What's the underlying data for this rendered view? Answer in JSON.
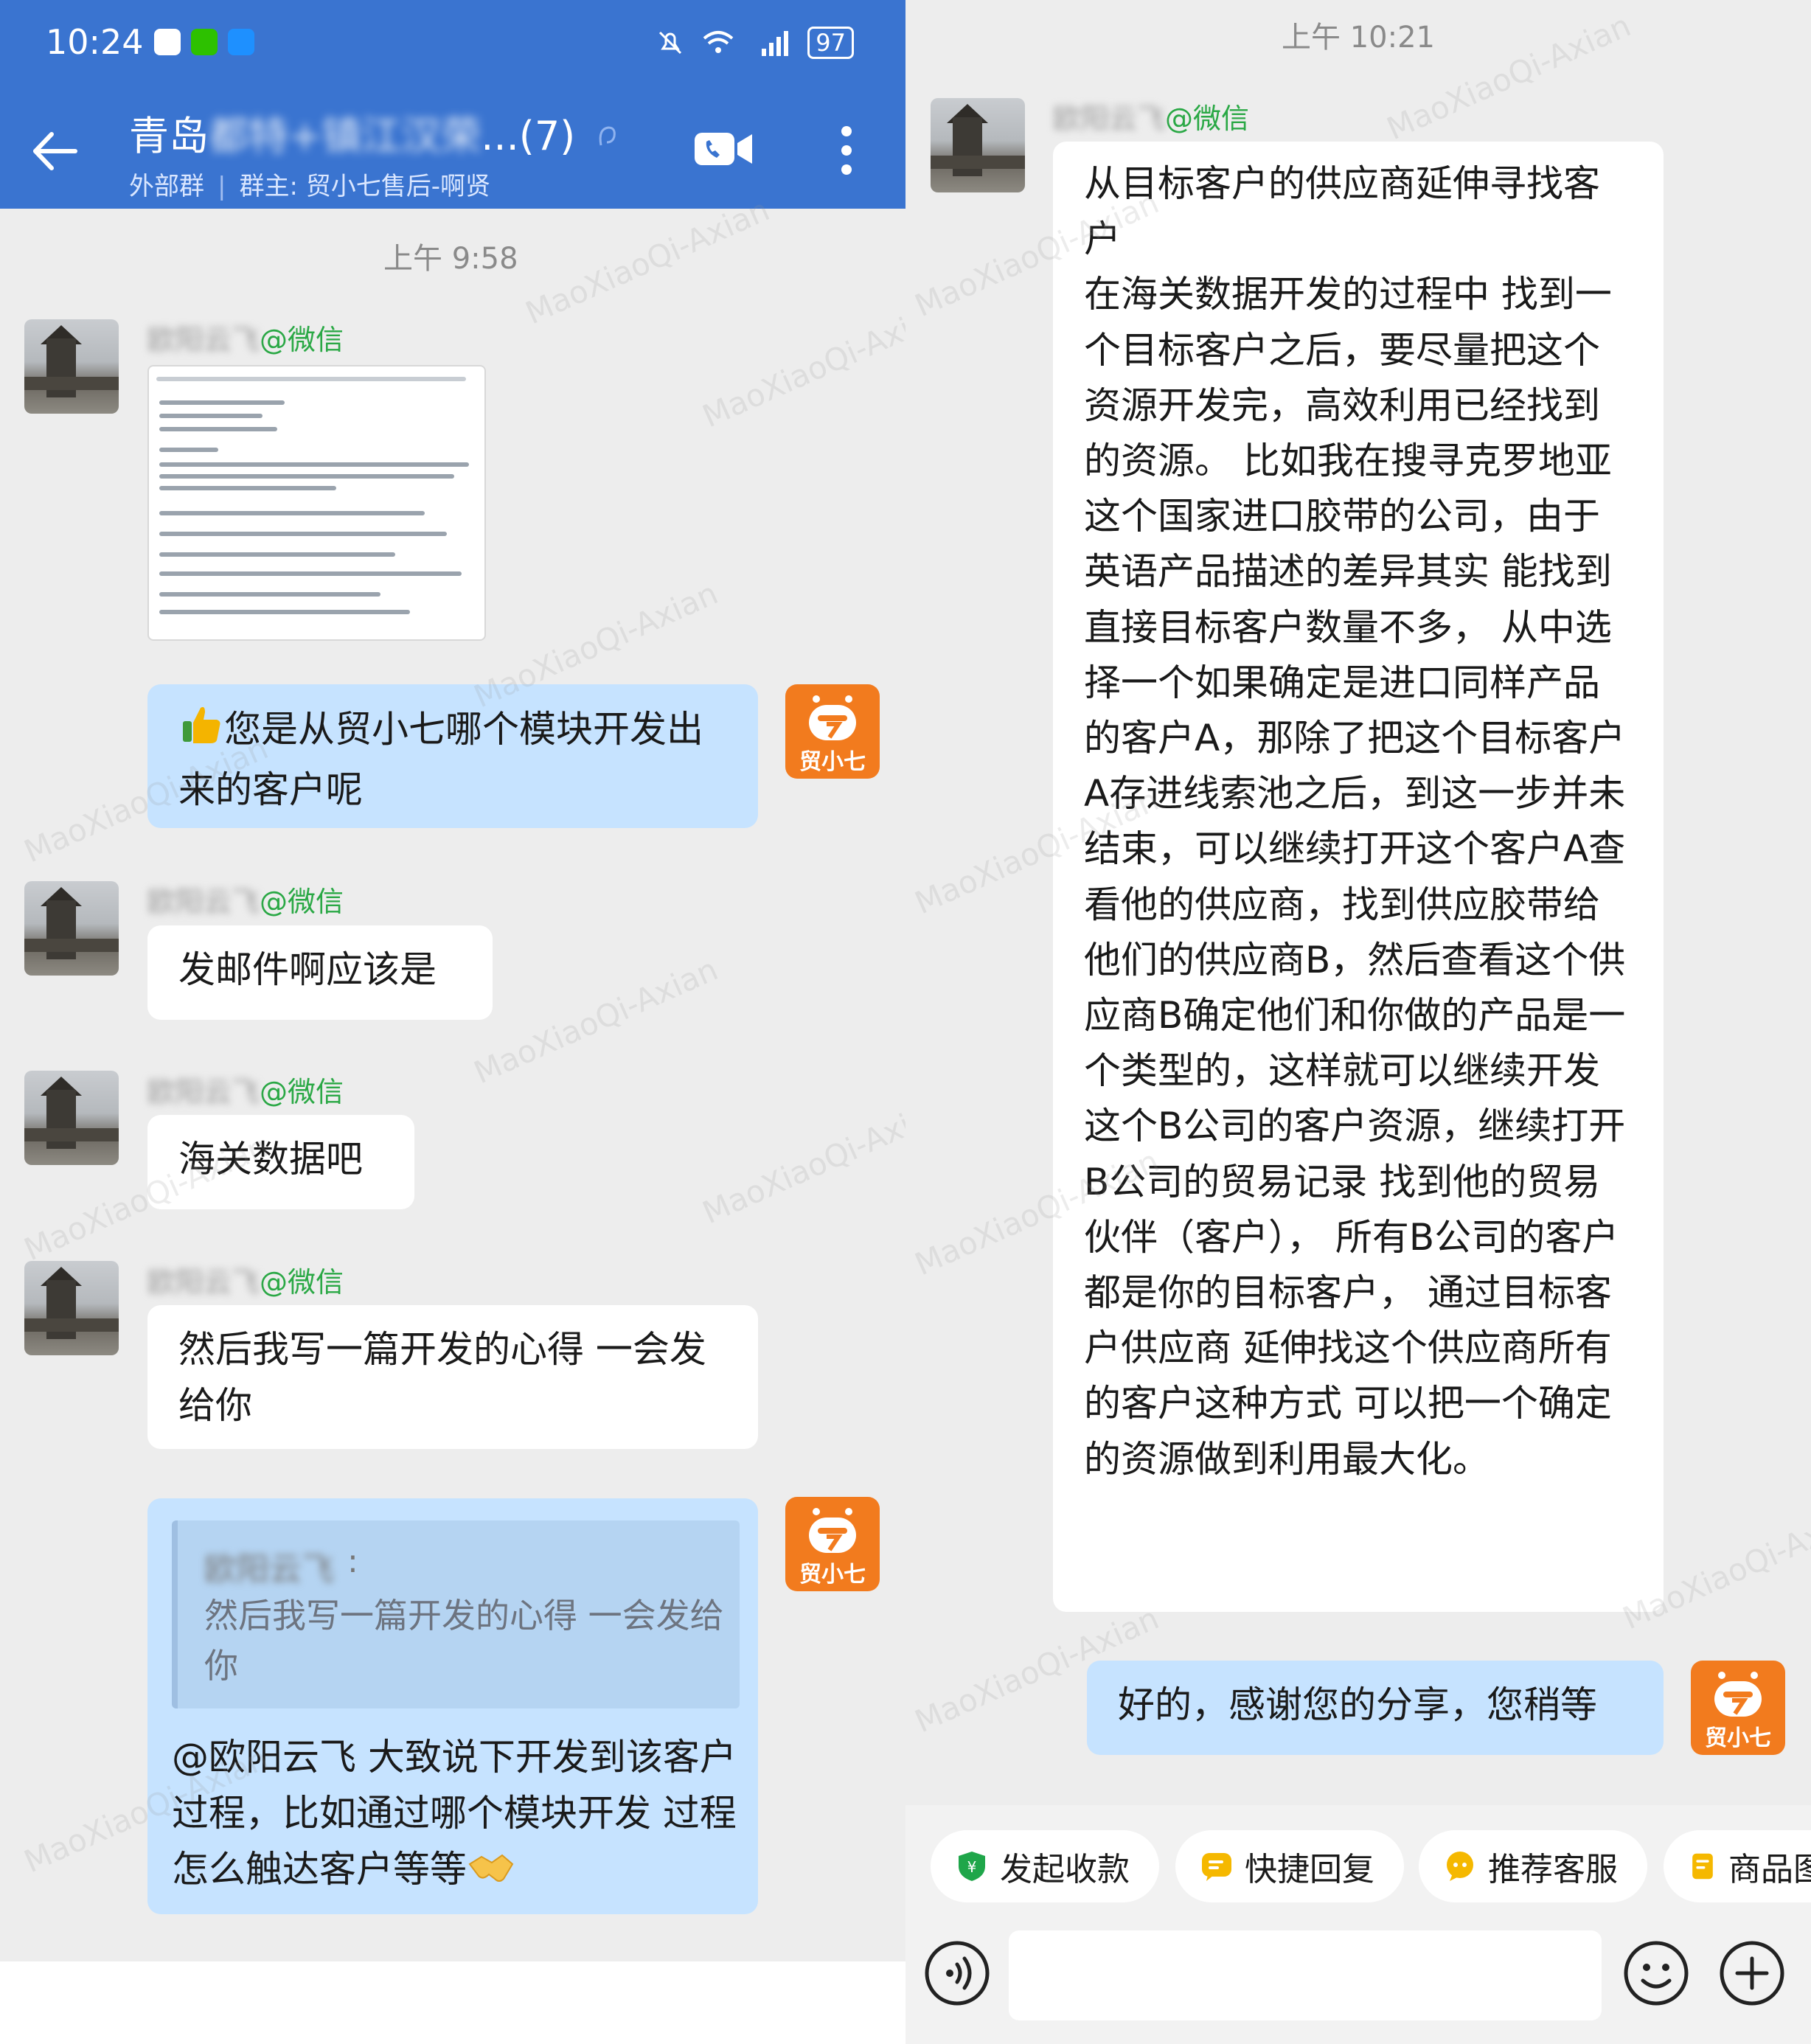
{
  "status_bar": {
    "time": "10:24",
    "battery": "97"
  },
  "chat_header": {
    "title_prefix": "青岛",
    "title_blurred": "都特+镇江汉荣",
    "title_suffix": "...(7)",
    "group_type": "外部群",
    "group_owner": "群主: 贸小七售后-啊贤"
  },
  "watermark_text": "MaoXiaoQi-Axian",
  "left_messages": {
    "time_1": "上午 9:58",
    "sender_name": "欧阳云飞",
    "sender_tag": "@微信",
    "bot_name": "贸小七",
    "msg_question": "您是从贸小七哪个模块开发出来的客户呢",
    "msg_email": "发邮件啊应该是",
    "msg_customs": "海关数据吧",
    "msg_write": "然后我写一篇开发的心得 一会发给你",
    "quote_name": "欧阳云飞",
    "quote_colon": ":",
    "quote_text": "然后我写一篇开发的心得 一会发给你",
    "reply_mention": "@欧阳云飞",
    "reply_text": " 大致说下开发到该客户过程，比如通过哪个模块开发 过程怎么触达客户等等"
  },
  "right_messages": {
    "time_1": "上午 10:21",
    "sender_name": "欧阳云飞",
    "sender_tag": "@微信",
    "long_message": "从目标客户的供应商延伸寻找客户\n在海关数据开发的过程中 找到一个目标客户之后，要尽量把这个资源开发完，高效利用已经找到的资源。 比如我在搜寻克罗地亚这个国家进口胶带的公司，由于英语产品描述的差异其实 能找到直接目标客户数量不多， 从中选择一个如果确定是进口同样产品的客户A，那除了把这个目标客户A存进线索池之后，到这一步并未结束，可以继续打开这个客户A查看他的供应商，找到供应胶带给他们的供应商B，然后查看这个供应商B确定他们和你做的产品是一个类型的，这样就可以继续开发这个B公司的客户资源，继续打开B公司的贸易记录 找到他的贸易伙伴（客户）， 所有B公司的客户都是你的目标客户， 通过目标客户供应商 延伸找这个供应商所有的客户这种方式 可以把一个确定的资源做到利用最大化。",
    "reply": "好的，感谢您的分享，您稍等",
    "bot_name": "贸小七"
  },
  "quick_actions": [
    {
      "label": "发起收款",
      "color": "#1fa64a"
    },
    {
      "label": "快捷回复",
      "color": "#f5b800"
    },
    {
      "label": "推荐客服",
      "color": "#f5b800"
    },
    {
      "label": "商品图",
      "color": "#f5b800"
    }
  ],
  "colors": {
    "header_blue": "#3a74d0",
    "bubble_blue": "#c6e3ff",
    "wechat_green": "#2aa845",
    "bot_orange": "#f27b1e"
  }
}
